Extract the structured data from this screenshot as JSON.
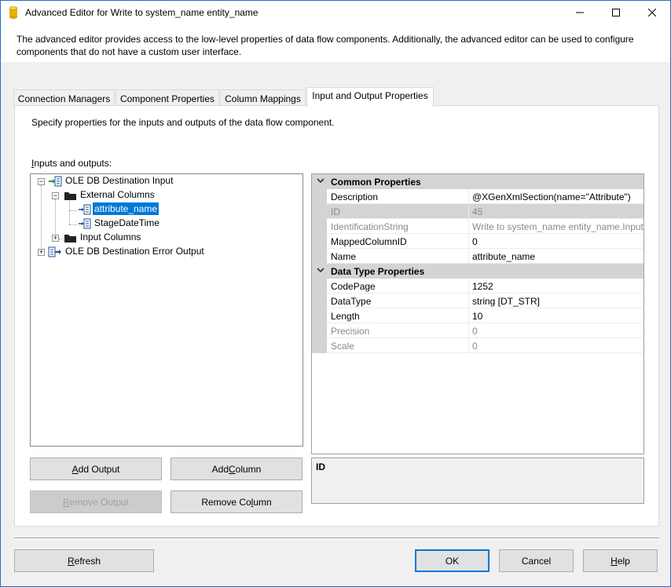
{
  "window": {
    "title": "Advanced Editor for Write to system_name entity_name",
    "icon": "cylinder-database-icon",
    "controls": [
      "minimize-icon",
      "maximize-icon",
      "close-icon"
    ]
  },
  "description": "The advanced editor provides access to the low-level properties of data flow components. Additionally, the advanced editor can be used to configure components that do not have a custom user interface.",
  "tabs": [
    {
      "label": "Connection Managers",
      "active": false
    },
    {
      "label": "Component Properties",
      "active": false
    },
    {
      "label": "Column Mappings",
      "active": false
    },
    {
      "label": "Input and Output Properties",
      "active": true
    }
  ],
  "panel": {
    "description": "Specify properties for the inputs and outputs of the data flow component.",
    "inputs_label_mnemonic": "I",
    "inputs_label_rest": "nputs and outputs:"
  },
  "tree": {
    "nodes": [
      {
        "label": "OLE DB Destination Input",
        "expanded": true,
        "icon": "input-icon"
      },
      {
        "label": "External Columns",
        "expanded": true,
        "icon": "folder-icon"
      },
      {
        "label": "attribute_name",
        "selected": true,
        "icon": "column-icon"
      },
      {
        "label": "StageDateTime",
        "icon": "column-icon"
      },
      {
        "label": "Input Columns",
        "expanded": false,
        "icon": "folder-icon"
      },
      {
        "label": "OLE DB Destination Error Output",
        "expanded": false,
        "icon": "output-icon"
      }
    ]
  },
  "buttons": {
    "add_output": {
      "pre": "",
      "mn": "A",
      "post": "dd Output",
      "enabled": true
    },
    "add_column": {
      "pre": "Add ",
      "mn": "C",
      "post": "olumn",
      "enabled": true
    },
    "remove_output": {
      "pre": "",
      "mn": "R",
      "post": "emove Output",
      "enabled": false
    },
    "remove_column": {
      "pre": "Remove Co",
      "mn": "l",
      "post": "umn",
      "enabled": true
    }
  },
  "properties": {
    "categories": [
      {
        "label": "Common Properties",
        "rows": [
          {
            "name": "Description",
            "value": "@XGenXmlSection(name=\"Attribute\")",
            "readonly": false
          },
          {
            "name": "ID",
            "value": "45",
            "readonly": true,
            "highlight": true
          },
          {
            "name": "IdentificationString",
            "value": "Write to system_name entity_name.Inputs",
            "readonly": true
          },
          {
            "name": "MappedColumnID",
            "value": "0",
            "readonly": false
          },
          {
            "name": "Name",
            "value": "attribute_name",
            "readonly": false
          }
        ]
      },
      {
        "label": "Data Type Properties",
        "rows": [
          {
            "name": "CodePage",
            "value": "1252",
            "readonly": false
          },
          {
            "name": "DataType",
            "value": "string [DT_STR]",
            "readonly": false
          },
          {
            "name": "Length",
            "value": "10",
            "readonly": false
          },
          {
            "name": "Precision",
            "value": "0",
            "readonly": true
          },
          {
            "name": "Scale",
            "value": "0",
            "readonly": true
          }
        ]
      }
    ]
  },
  "help": {
    "title": "ID"
  },
  "footer": {
    "refresh": {
      "pre": "",
      "mn": "R",
      "post": "efresh"
    },
    "ok": "OK",
    "cancel": "Cancel",
    "help": {
      "pre": "",
      "mn": "H",
      "post": "elp"
    }
  }
}
